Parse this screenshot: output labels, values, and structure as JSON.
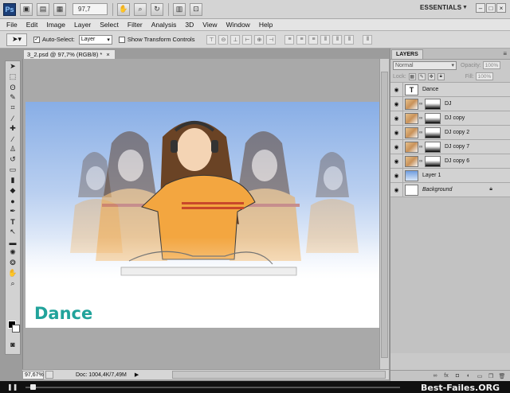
{
  "appbar": {
    "logo": "Ps",
    "zoom": "97,7",
    "workspace": "ESSENTIALS",
    "minimize": "–",
    "restore": "□",
    "close": "×"
  },
  "menu": [
    "File",
    "Edit",
    "Image",
    "Layer",
    "Select",
    "Filter",
    "Analysis",
    "3D",
    "View",
    "Window",
    "Help"
  ],
  "options": {
    "auto_select_label": "Auto-Select:",
    "auto_select_value": "Layer",
    "transform_label": "Show Transform Controls"
  },
  "document": {
    "tab_title": "3_2.psd @ 97,7% (RGB/8) *",
    "canvas_title": "Dance",
    "colors": {
      "sky_top": "#88aee6",
      "title": "#21a39b",
      "shirt": "#f3a640"
    }
  },
  "status": {
    "zoom": "97,67%",
    "doc_info": "Doc: 1004,4K/7,49M"
  },
  "layers_panel": {
    "tab": "LAYERS",
    "blend_mode": "Normal",
    "opacity_label": "Opacity:",
    "opacity_value": "100%",
    "lock_label": "Lock:",
    "fill_label": "Fill:",
    "fill_value": "100%",
    "layers": [
      {
        "name": "Dance",
        "kind": "text",
        "thumb": "T"
      },
      {
        "name": "DJ",
        "kind": "masked"
      },
      {
        "name": "DJ copy",
        "kind": "masked"
      },
      {
        "name": "DJ copy 2",
        "kind": "masked"
      },
      {
        "name": "DJ copy 7",
        "kind": "masked"
      },
      {
        "name": "DJ copy 6",
        "kind": "masked"
      },
      {
        "name": "Layer 1",
        "kind": "fill"
      },
      {
        "name": "Background",
        "kind": "background"
      }
    ]
  },
  "player": {
    "watermark": "Best-Failes.ORG",
    "progress": 0.013
  }
}
